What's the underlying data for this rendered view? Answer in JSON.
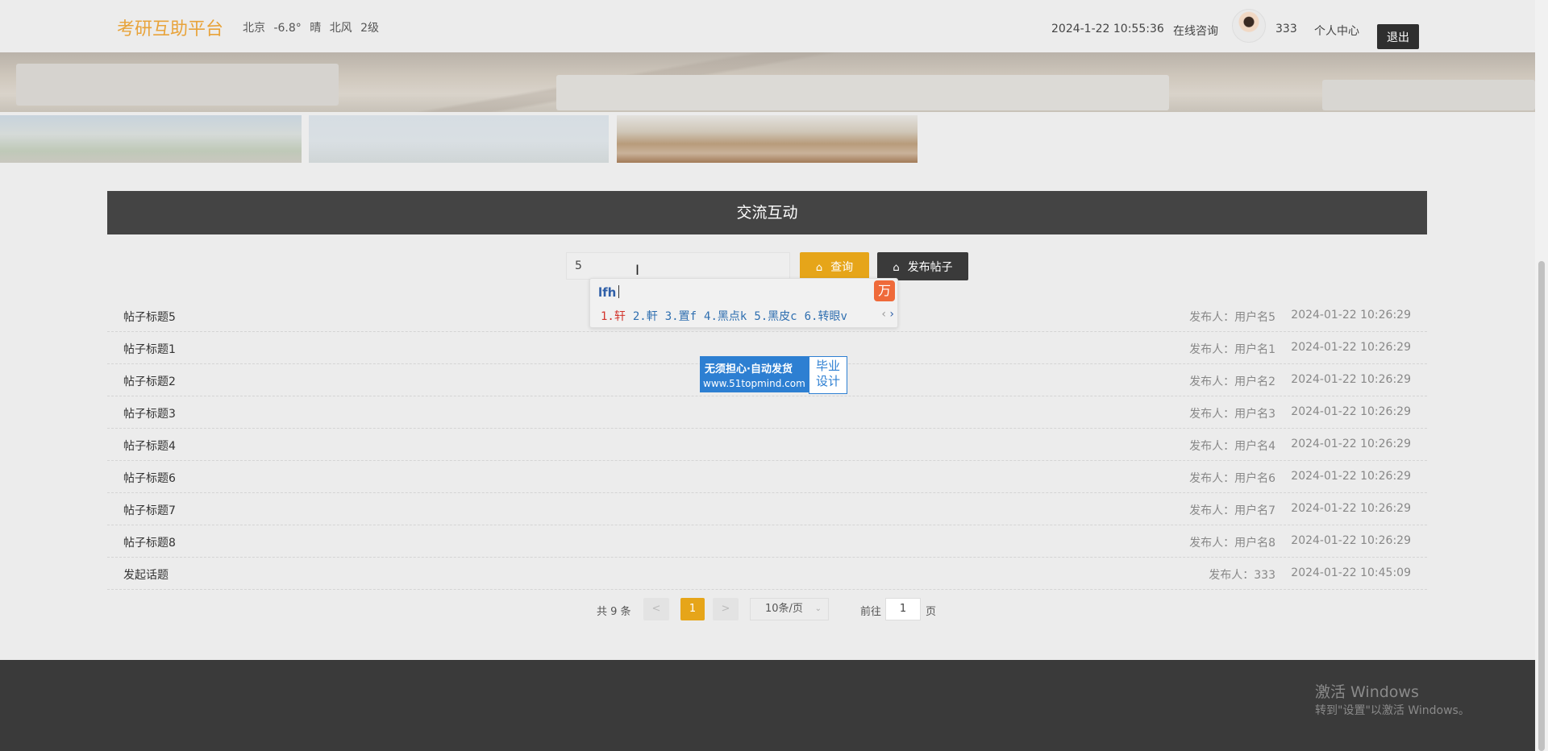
{
  "header": {
    "logo": "考研互助平台",
    "weather": {
      "city": "北京",
      "temp": "-6.8°",
      "condition": "晴",
      "wind_dir": "北风",
      "wind_level": "2级"
    },
    "datetime": "2024-1-22 10:55:36",
    "consult_label": "在线咨询",
    "username": "333",
    "profile_label": "个人中心",
    "logout_label": "退出"
  },
  "section": {
    "title": "交流互动"
  },
  "search": {
    "value": "5",
    "search_label": "查询",
    "post_label": "发布帖子",
    "search_icon": "home-icon",
    "post_icon": "home-icon"
  },
  "ime": {
    "composition": "lfh",
    "candidates": [
      "1.轩",
      "2.軒",
      "3.置f",
      "4.黑点k",
      "5.黑皮c",
      "6.转眼v"
    ],
    "prev_arrow": "‹",
    "next_arrow": "›",
    "logo_glyph": "万"
  },
  "posts": [
    {
      "title": "帖子标题5",
      "author": "发布人：用户名5",
      "time": "2024-01-22 10:26:29"
    },
    {
      "title": "帖子标题1",
      "author": "发布人：用户名1",
      "time": "2024-01-22 10:26:29"
    },
    {
      "title": "帖子标题2",
      "author": "发布人：用户名2",
      "time": "2024-01-22 10:26:29"
    },
    {
      "title": "帖子标题3",
      "author": "发布人：用户名3",
      "time": "2024-01-22 10:26:29"
    },
    {
      "title": "帖子标题4",
      "author": "发布人：用户名4",
      "time": "2024-01-22 10:26:29"
    },
    {
      "title": "帖子标题6",
      "author": "发布人：用户名6",
      "time": "2024-01-22 10:26:29"
    },
    {
      "title": "帖子标题7",
      "author": "发布人：用户名7",
      "time": "2024-01-22 10:26:29"
    },
    {
      "title": "帖子标题8",
      "author": "发布人：用户名8",
      "time": "2024-01-22 10:26:29"
    },
    {
      "title": "发起话题",
      "author": "发布人：333",
      "time": "2024-01-22 10:45:09"
    }
  ],
  "ad": {
    "line1": "无须担心·自动发货",
    "line2": "www.51topmind.com",
    "right1": "毕业",
    "right2": "设计"
  },
  "pagination": {
    "total": "共 9 条",
    "prev": "<",
    "current": "1",
    "next": ">",
    "page_size": "10条/页",
    "goto_label": "前往",
    "goto_value": "1",
    "page_unit": "页"
  },
  "windows_activation": {
    "line1": "激活 Windows",
    "line2": "转到\"设置\"以激活 Windows。"
  },
  "colors": {
    "accent": "#e6a519",
    "dark": "#3a3a3a",
    "logo": "#e8a33a"
  }
}
